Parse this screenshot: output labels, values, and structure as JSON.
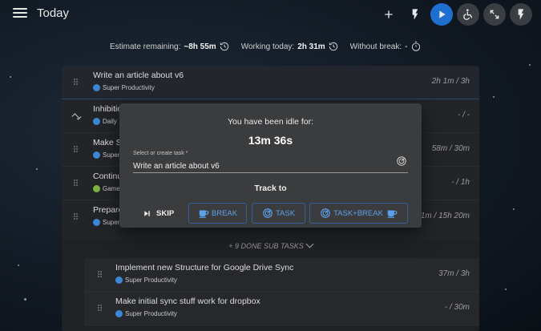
{
  "header": {
    "title": "Today",
    "actions": [
      {
        "name": "add-task-button",
        "icon": "plus-icon"
      },
      {
        "name": "focus-mode-button",
        "icon": "flash-icon"
      },
      {
        "name": "play-button",
        "icon": "play-icon"
      },
      {
        "name": "accessibility-button",
        "icon": "wheelchair-icon"
      },
      {
        "name": "fullscreen-button",
        "icon": "expand-icon"
      },
      {
        "name": "power-mode-button",
        "icon": "flash-icon"
      }
    ]
  },
  "metrics": {
    "estimate_label": "Estimate remaining:",
    "estimate_value": "~8h 55m",
    "working_label": "Working today:",
    "working_value": "2h 31m",
    "break_label": "Without break:",
    "break_value": "-"
  },
  "tasks": [
    {
      "title": "Write an article about v6",
      "tag": "Super Productivity",
      "tag_color": "#3d86d6",
      "time": "2h 1m / 3h"
    },
    {
      "title": "Inhibition",
      "tag": "Daily",
      "tag_color": "#3d86d6",
      "time": "- / -"
    },
    {
      "title": "Make S",
      "tag": "Super",
      "tag_color": "#3d86d6",
      "time": "58m / 30m"
    },
    {
      "title": "Continu",
      "tag": "Game",
      "tag_color": "#7cb342",
      "time": "- / 1h"
    },
    {
      "title": "Prepare",
      "tag": "Super",
      "tag_color": "#3d86d6",
      "time": "1m / 15h 20m"
    }
  ],
  "done_toggle": "+ 9 DONE SUB TASKS",
  "subtasks": [
    {
      "title": "Implement new Structure for Google Drive Sync",
      "tag": "Super Productivity",
      "tag_color": "#3d86d6",
      "time": "37m / 3h"
    },
    {
      "title": "Make initial sync stuff work for dropbox",
      "tag": "Super Productivity",
      "tag_color": "#3d86d6",
      "time": "- / 30m"
    }
  ],
  "idle_dialog": {
    "title": "You have been idle for:",
    "idle_time": "13m 36s",
    "field_label": "Select or create task *",
    "field_value": "Write an article about v6",
    "track_label": "Track to",
    "skip_label": "SKIP",
    "break_label": "BREAK",
    "task_label": "TASK",
    "task_break_label": "TASK+BREAK"
  },
  "colors": {
    "accent": "#1e6fcf",
    "outline_button_text": "#5da0ea",
    "dialog_bg": "#3b3c3e"
  }
}
